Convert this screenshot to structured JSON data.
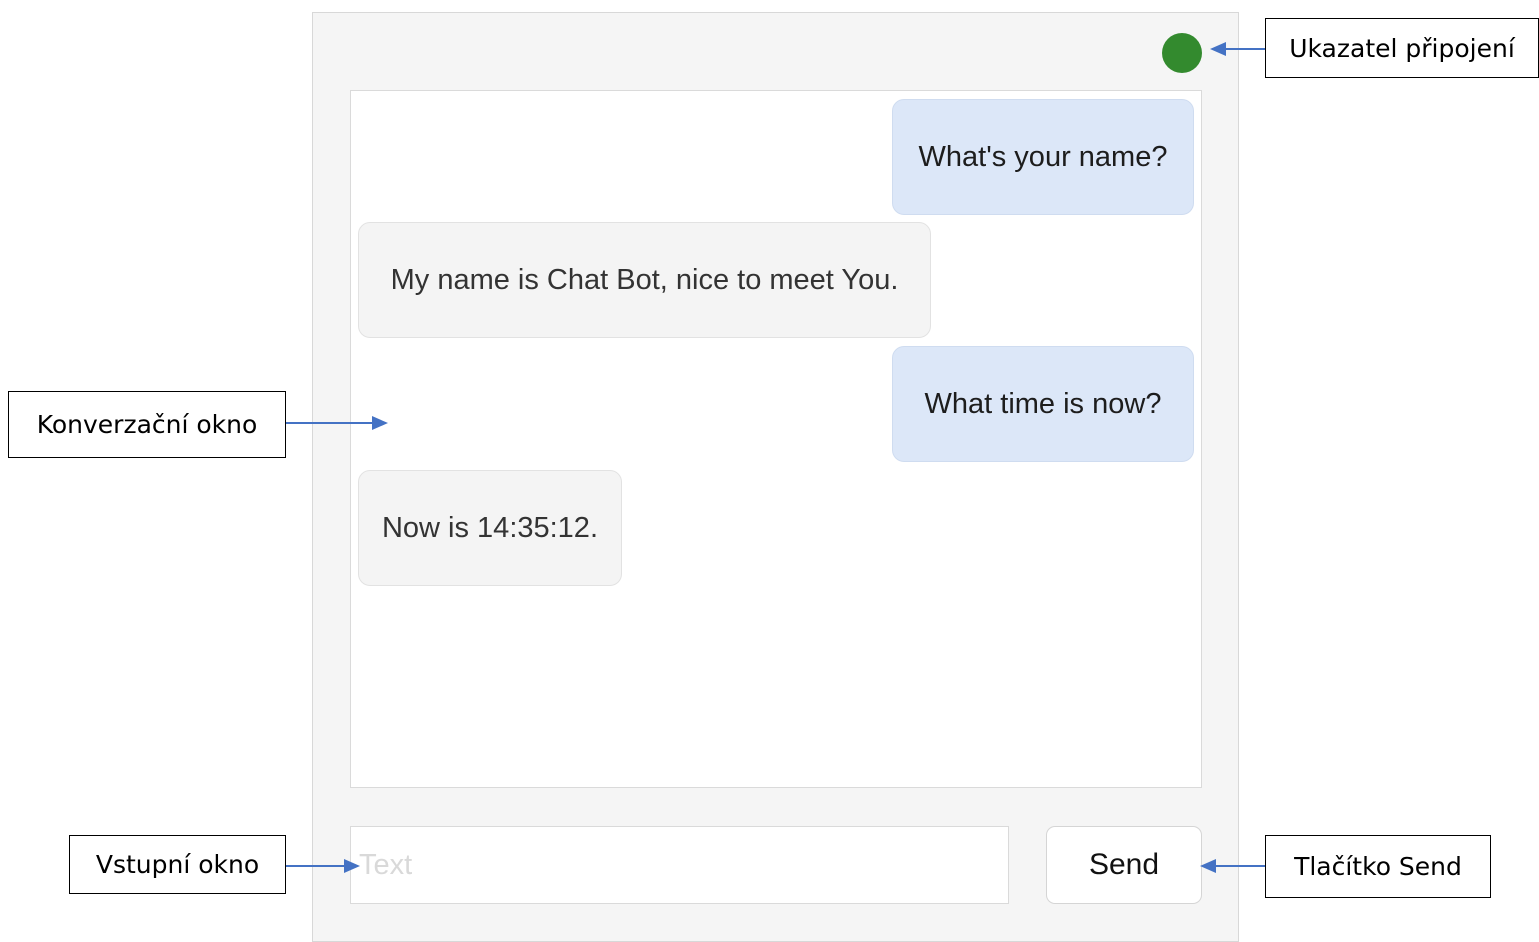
{
  "conversation": {
    "messages": [
      {
        "sender": "user",
        "text": "What's your name?"
      },
      {
        "sender": "bot",
        "text": "My name is Chat Bot, nice to meet You."
      },
      {
        "sender": "user",
        "text": "What time is now?"
      },
      {
        "sender": "bot",
        "text": "Now is 14:35:12."
      }
    ]
  },
  "input": {
    "placeholder": "Text",
    "value": ""
  },
  "send_button": {
    "label": "Send"
  },
  "status": {
    "state": "connected",
    "color": "#338a2e"
  },
  "annotations": {
    "status_indicator": "Ukazatel připojení",
    "conversation_window": "Konverzační okno",
    "input_window": "Vstupní okno",
    "send_button": "Tlačítko Send",
    "arrow_color": "#4472c4"
  },
  "colors": {
    "user_bubble": "#dce7f8",
    "bot_bubble": "#f4f4f4",
    "panel": "#f5f5f5"
  }
}
